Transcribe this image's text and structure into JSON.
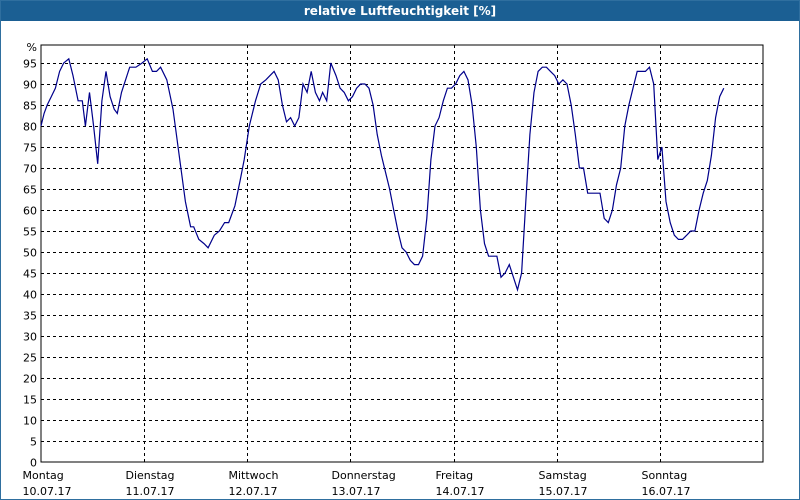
{
  "window": {
    "title": "relative Luftfeuchtigkeit [%]"
  },
  "chart_data": {
    "type": "line",
    "title": "relative Luftfeuchtigkeit [%]",
    "ylabel": "%",
    "ylim": [
      0,
      95
    ],
    "yticks": [
      0,
      5,
      10,
      15,
      20,
      25,
      30,
      35,
      40,
      45,
      50,
      55,
      60,
      65,
      70,
      75,
      80,
      85,
      90,
      95
    ],
    "xlim": [
      0,
      7
    ],
    "grid": true,
    "days": [
      {
        "day": "Montag",
        "date": "10.07.17"
      },
      {
        "day": "Dienstag",
        "date": "11.07.17"
      },
      {
        "day": "Mittwoch",
        "date": "12.07.17"
      },
      {
        "day": "Donnerstag",
        "date": "13.07.17"
      },
      {
        "day": "Freitag",
        "date": "14.07.17"
      },
      {
        "day": "Samstag",
        "date": "15.07.17"
      },
      {
        "day": "Sonntag",
        "date": "16.07.17"
      }
    ],
    "series": [
      {
        "color": "#00008b",
        "points": [
          [
            0.0,
            80
          ],
          [
            0.03,
            83
          ],
          [
            0.06,
            85
          ],
          [
            0.1,
            87
          ],
          [
            0.14,
            89
          ],
          [
            0.18,
            93
          ],
          [
            0.22,
            95
          ],
          [
            0.27,
            96
          ],
          [
            0.31,
            92
          ],
          [
            0.36,
            86
          ],
          [
            0.4,
            86
          ],
          [
            0.43,
            80
          ],
          [
            0.47,
            88
          ],
          [
            0.51,
            80
          ],
          [
            0.55,
            71
          ],
          [
            0.59,
            86
          ],
          [
            0.63,
            93
          ],
          [
            0.67,
            87
          ],
          [
            0.71,
            84
          ],
          [
            0.74,
            83
          ],
          [
            0.78,
            88
          ],
          [
            0.86,
            94
          ],
          [
            0.92,
            94
          ],
          [
            0.98,
            95
          ],
          [
            1.03,
            96
          ],
          [
            1.08,
            93
          ],
          [
            1.12,
            93
          ],
          [
            1.16,
            94
          ],
          [
            1.22,
            91
          ],
          [
            1.28,
            84
          ],
          [
            1.34,
            73
          ],
          [
            1.4,
            62
          ],
          [
            1.45,
            56
          ],
          [
            1.48,
            56
          ],
          [
            1.53,
            53
          ],
          [
            1.58,
            52
          ],
          [
            1.62,
            51
          ],
          [
            1.68,
            54
          ],
          [
            1.73,
            55
          ],
          [
            1.78,
            57
          ],
          [
            1.82,
            57
          ],
          [
            1.88,
            61
          ],
          [
            1.93,
            67
          ],
          [
            1.97,
            72
          ],
          [
            2.02,
            80
          ],
          [
            2.08,
            86
          ],
          [
            2.13,
            90
          ],
          [
            2.18,
            91
          ],
          [
            2.22,
            92
          ],
          [
            2.26,
            93
          ],
          [
            2.3,
            91
          ],
          [
            2.34,
            85
          ],
          [
            2.38,
            81
          ],
          [
            2.42,
            82
          ],
          [
            2.46,
            80
          ],
          [
            2.5,
            82
          ],
          [
            2.54,
            90
          ],
          [
            2.58,
            88
          ],
          [
            2.62,
            93
          ],
          [
            2.66,
            88
          ],
          [
            2.7,
            86
          ],
          [
            2.73,
            88
          ],
          [
            2.77,
            86
          ],
          [
            2.81,
            95
          ],
          [
            2.86,
            92
          ],
          [
            2.9,
            89
          ],
          [
            2.94,
            88
          ],
          [
            2.98,
            86
          ],
          [
            3.02,
            87
          ],
          [
            3.06,
            89
          ],
          [
            3.1,
            90
          ],
          [
            3.14,
            90
          ],
          [
            3.18,
            89
          ],
          [
            3.22,
            85
          ],
          [
            3.26,
            78
          ],
          [
            3.3,
            73
          ],
          [
            3.34,
            69
          ],
          [
            3.38,
            65
          ],
          [
            3.42,
            60
          ],
          [
            3.46,
            55
          ],
          [
            3.5,
            51
          ],
          [
            3.54,
            50
          ],
          [
            3.58,
            48
          ],
          [
            3.62,
            47
          ],
          [
            3.66,
            47
          ],
          [
            3.7,
            49
          ],
          [
            3.74,
            58
          ],
          [
            3.78,
            72
          ],
          [
            3.82,
            80
          ],
          [
            3.86,
            82
          ],
          [
            3.9,
            86
          ],
          [
            3.94,
            89
          ],
          [
            3.98,
            89
          ],
          [
            4.02,
            90
          ],
          [
            4.06,
            92
          ],
          [
            4.1,
            93
          ],
          [
            4.14,
            91
          ],
          [
            4.18,
            85
          ],
          [
            4.22,
            75
          ],
          [
            4.26,
            60
          ],
          [
            4.3,
            52
          ],
          [
            4.34,
            49
          ],
          [
            4.38,
            49
          ],
          [
            4.42,
            49
          ],
          [
            4.46,
            44
          ],
          [
            4.5,
            45
          ],
          [
            4.54,
            47
          ],
          [
            4.58,
            44
          ],
          [
            4.62,
            41
          ],
          [
            4.66,
            45
          ],
          [
            4.7,
            62
          ],
          [
            4.74,
            78
          ],
          [
            4.78,
            88
          ],
          [
            4.82,
            93
          ],
          [
            4.86,
            94
          ],
          [
            4.9,
            94
          ],
          [
            4.94,
            93
          ],
          [
            4.98,
            92
          ],
          [
            5.02,
            90
          ],
          [
            5.06,
            91
          ],
          [
            5.1,
            90
          ],
          [
            5.14,
            85
          ],
          [
            5.18,
            78
          ],
          [
            5.22,
            70
          ],
          [
            5.26,
            70
          ],
          [
            5.3,
            64
          ],
          [
            5.34,
            64
          ],
          [
            5.38,
            64
          ],
          [
            5.42,
            64
          ],
          [
            5.46,
            58
          ],
          [
            5.5,
            57
          ],
          [
            5.54,
            60
          ],
          [
            5.58,
            66
          ],
          [
            5.62,
            70
          ],
          [
            5.66,
            80
          ],
          [
            5.7,
            85
          ],
          [
            5.74,
            89
          ],
          [
            5.78,
            93
          ],
          [
            5.82,
            93
          ],
          [
            5.86,
            93
          ],
          [
            5.9,
            94
          ],
          [
            5.94,
            90
          ],
          [
            5.98,
            72
          ],
          [
            6.02,
            75
          ],
          [
            6.06,
            62
          ],
          [
            6.1,
            57
          ],
          [
            6.14,
            54
          ],
          [
            6.18,
            53
          ],
          [
            6.22,
            53
          ],
          [
            6.26,
            54
          ],
          [
            6.3,
            55
          ],
          [
            6.34,
            55
          ],
          [
            6.38,
            60
          ],
          [
            6.42,
            64
          ],
          [
            6.46,
            67
          ],
          [
            6.5,
            73
          ],
          [
            6.54,
            82
          ],
          [
            6.58,
            87
          ],
          [
            6.62,
            89
          ]
        ]
      }
    ]
  }
}
